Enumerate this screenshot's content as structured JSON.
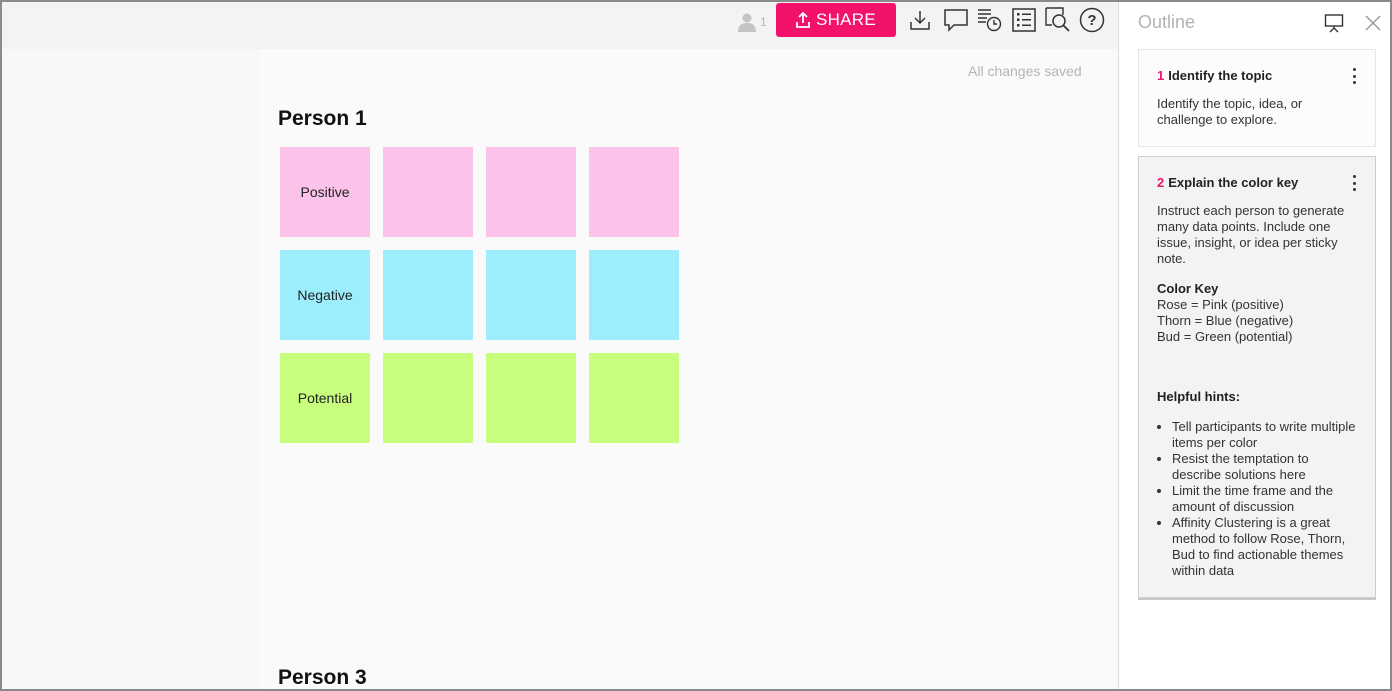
{
  "toolbar": {
    "user_count": "1",
    "share_label": "SHARE",
    "icons": [
      "user-icon",
      "share-upload-icon",
      "download-icon",
      "comment-icon",
      "history-icon",
      "outline-list-icon",
      "search-icon",
      "help-icon"
    ]
  },
  "status": {
    "saved_text": "All changes saved"
  },
  "board": {
    "person1_title": "Person 1",
    "person3_title": "Person 3",
    "notes": {
      "positive": "Positive",
      "negative": "Negative",
      "potential": "Potential"
    },
    "colors": {
      "pink": "#fbc2ea",
      "blue": "#9deefc",
      "green": "#c8fe7d",
      "accent": "#f2126b"
    }
  },
  "outline": {
    "title": "Outline",
    "icons": [
      "present-icon",
      "close-icon"
    ],
    "steps": [
      {
        "num": "1",
        "title": "Identify the topic",
        "body": "Identify the topic, idea, or challenge to explore."
      },
      {
        "num": "2",
        "title": "Explain the color key",
        "body": "Instruct each person to generate many data points. Include one issue, insight, or idea per sticky note.",
        "key_title": "Color Key",
        "key_lines": [
          "Rose = Pink (positive)",
          "Thorn = Blue (negative)",
          "Bud = Green (potential)"
        ],
        "hints_title": "Helpful hints:",
        "hints": [
          "Tell participants to write multiple items per color",
          "Resist the temptation to describe solutions here",
          "Limit the time frame and the amount of discussion",
          "Affinity Clustering is a great method to follow Rose, Thorn, Bud to find actionable themes within data"
        ]
      }
    ]
  }
}
